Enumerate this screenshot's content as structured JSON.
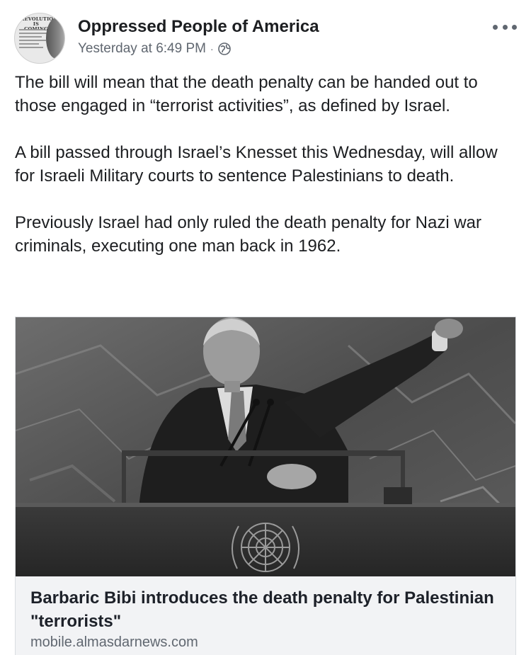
{
  "post": {
    "page_name": "Oppressed People of America",
    "timestamp": "Yesterday at 6:49 PM",
    "separator": "·",
    "privacy_icon": "globe-icon",
    "more_icon": "more-options-icon",
    "avatar": {
      "caption_line1": "REVOLUTION",
      "caption_line2": "IS COMING"
    },
    "paragraphs": [
      "The bill will mean that the death penalty can be handed out to those engaged in “terrorist activities”, as defined by Israel.",
      "A bill passed through Israel’s Knesset this Wednesday, will allow for Israeli Military courts to sentence Palestinians to death.",
      "Previously Israel had only ruled the death penalty for Nazi war criminals, executing one man back in 1962."
    ]
  },
  "link_card": {
    "title": "Barbaric Bibi introduces the death penalty for Palestinian \"terrorists\"",
    "domain": "mobile.almasdarnews.com"
  },
  "colors": {
    "text_primary": "#1c1e21",
    "text_secondary": "#606770",
    "card_background": "#f2f3f5",
    "border": "#dadde1"
  }
}
